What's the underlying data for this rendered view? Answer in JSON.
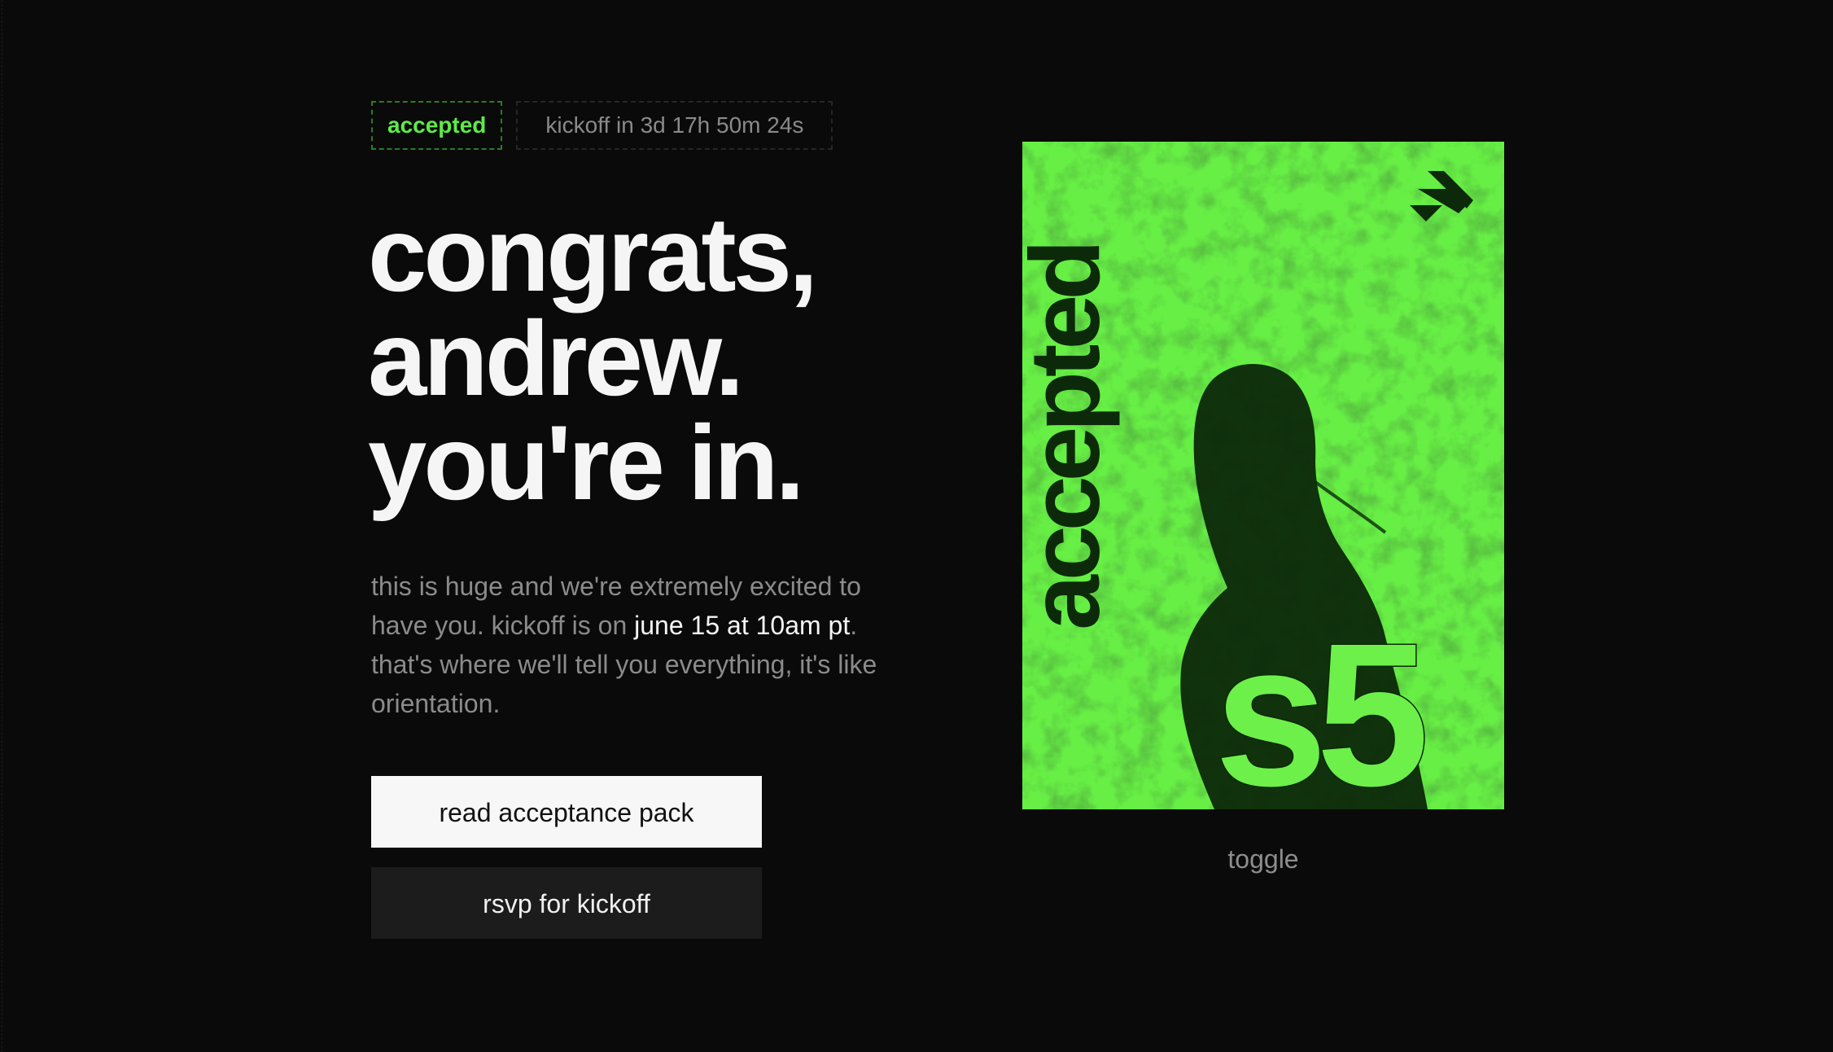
{
  "status": {
    "badge": "accepted",
    "countdown": "kickoff in 3d 17h 50m 24s"
  },
  "headline": {
    "line1": "congrats,",
    "line2": "andrew.",
    "line3": "you're in."
  },
  "intro": {
    "part1": "this is huge and we're extremely excited to have you. kickoff is on ",
    "highlight": "june 15 at 10am pt",
    "part2": ". that's where we'll tell you everything, it's like orientation."
  },
  "actions": {
    "primary_label": "read acceptance pack",
    "secondary_label": "rsvp for kickoff"
  },
  "poster": {
    "vertical_text": "accepted",
    "season": "s5",
    "logo_icon": "stacked-chevron-logo-icon",
    "background_color": "#67ef45",
    "ink_color": "#0c2a0a"
  },
  "toggle_label": "toggle"
}
